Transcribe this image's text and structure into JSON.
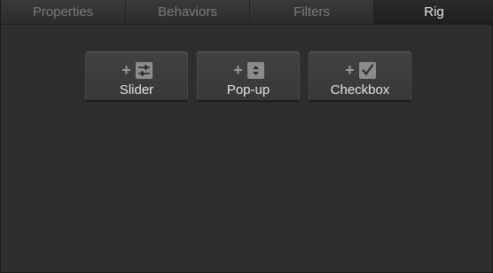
{
  "tabs": [
    {
      "label": "Properties",
      "active": false
    },
    {
      "label": "Behaviors",
      "active": false
    },
    {
      "label": "Filters",
      "active": false
    },
    {
      "label": "Rig",
      "active": true
    }
  ],
  "widgets": {
    "slider": {
      "label": "Slider",
      "icon": "slider-icon"
    },
    "popup": {
      "label": "Pop-up",
      "icon": "popup-icon"
    },
    "checkbox": {
      "label": "Checkbox",
      "icon": "checkbox-icon"
    }
  },
  "colors": {
    "background": "#2e2e2e",
    "active_tab_text": "#e6e6e6",
    "inactive_tab_text": "#7a7a7a",
    "button_text": "#e4e4e4",
    "icon_fill": "#8c8c8c"
  }
}
